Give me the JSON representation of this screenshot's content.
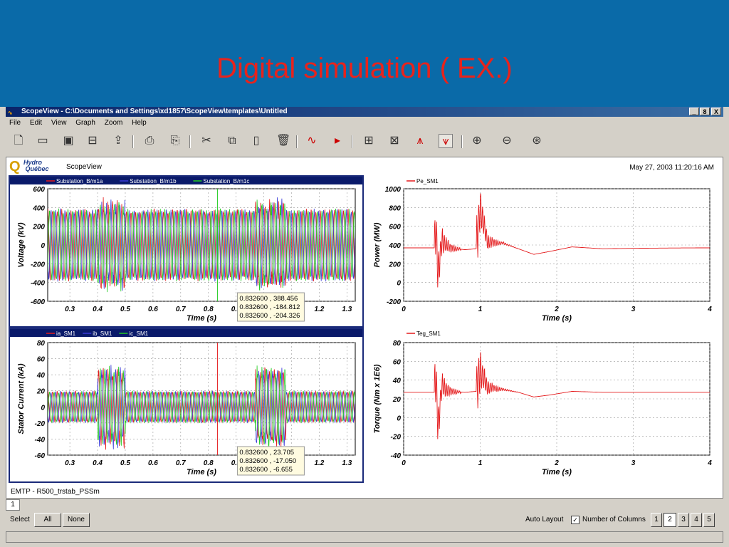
{
  "slide": {
    "title": "Digital simulation ( EX.)",
    "background": "#0a6aa8",
    "title_color": "#e8231c"
  },
  "window": {
    "title": "ScopeView - C:\\Documents and Settings\\xd1857\\ScopeView\\templates\\Untitled",
    "controls": [
      "_",
      "8",
      "X"
    ],
    "app_icon": "scopeview-logo-icon"
  },
  "menu": [
    "File",
    "Edit",
    "View",
    "Graph",
    "Zoom",
    "Help"
  ],
  "toolbar": {
    "icons": [
      "new-icon",
      "open-icon",
      "save-icon",
      "save-as-icon",
      "export-icon",
      "print-icon",
      "print-preview-icon",
      "cut-icon",
      "copy-icon",
      "paste-icon",
      "delete-icon",
      "add-signal-icon",
      "play-signal-icon",
      "layout-icon",
      "layout2-icon",
      "cursor-icon",
      "cursor-active-icon",
      "zoom-in-icon",
      "zoom-out-icon",
      "zoom-fit-icon"
    ]
  },
  "header": {
    "logo_line1": "Hydro",
    "logo_line2": "Québec",
    "app_name": "ScopeView",
    "timestamp": "May 27, 2003 11:20:16 AM"
  },
  "footer": {
    "case_name": "EMTP - R500_trstab_PSSm"
  },
  "tab": {
    "label": "1"
  },
  "bottombar": {
    "select_label": "Select",
    "all_label": "All",
    "none_label": "None",
    "auto_layout_label": "Auto Layout",
    "auto_layout_checked": "✓",
    "columns_label": "Number of Columns",
    "columns": [
      "1",
      "2",
      "3",
      "4",
      "5"
    ],
    "selected_column": "2"
  },
  "chart_data": [
    {
      "type": "line",
      "ylabel": "Voltage (kV)",
      "xlabel": "Time (s)",
      "xlim": [
        0.22,
        1.33
      ],
      "ylim": [
        -600,
        600
      ],
      "xticks": [
        "0.3",
        "0.4",
        "0.5",
        "0.6",
        "0.7",
        "0.8",
        "0.9",
        "1",
        "1.1",
        "1.2",
        "1.3"
      ],
      "yticks": [
        "600",
        "400",
        "200",
        "0",
        "-200",
        "-400",
        "-600"
      ],
      "series": [
        {
          "name": "Substation_B/m1a",
          "color": "#e41a1c"
        },
        {
          "name": "Substation_B/m1b",
          "color": "#3b3bd9"
        },
        {
          "name": "Substation_B/m1c",
          "color": "#22cc22"
        }
      ],
      "cursor_x": 0.8326,
      "cursor_readouts": [
        "0.832600 , 388.456",
        "0.832600 , -184.812",
        "0.832600 , -204.326"
      ],
      "grid": true,
      "legend": "top"
    },
    {
      "type": "line",
      "ylabel": "Power (MW)",
      "xlabel": "Time (s)",
      "xlim": [
        0,
        4
      ],
      "ylim": [
        -200,
        1000
      ],
      "xticks": [
        "0",
        "1",
        "2",
        "3",
        "4"
      ],
      "yticks": [
        "1000",
        "800",
        "600",
        "400",
        "200",
        "0",
        "-200"
      ],
      "series": [
        {
          "name": "Pe_SM1",
          "color": "#e41a1c",
          "x": [
            0,
            0.4,
            0.42,
            0.45,
            0.5,
            0.6,
            0.8,
            0.95,
            1.0,
            1.1,
            1.3,
            1.5,
            1.7,
            1.9,
            2.2,
            2.6,
            3.0,
            3.5,
            4.0
          ],
          "y": [
            370,
            370,
            600,
            100,
            450,
            370,
            350,
            360,
            800,
            430,
            420,
            360,
            300,
            330,
            380,
            360,
            365,
            368,
            370
          ]
        }
      ],
      "grid": true,
      "legend": "top"
    },
    {
      "type": "line",
      "ylabel": "Stator Current (kA)",
      "xlabel": "Time (s)",
      "xlim": [
        0.22,
        1.33
      ],
      "ylim": [
        -60,
        80
      ],
      "xticks": [
        "0.3",
        "0.4",
        "0.5",
        "0.6",
        "0.7",
        "0.8",
        "0.9",
        "1",
        "1.1",
        "1.2",
        "1.3"
      ],
      "yticks": [
        "80",
        "60",
        "40",
        "20",
        "0",
        "-20",
        "-40",
        "-60"
      ],
      "series": [
        {
          "name": "ia_SM1",
          "color": "#e41a1c"
        },
        {
          "name": "ib_SM1",
          "color": "#3b3bd9"
        },
        {
          "name": "ic_SM1",
          "color": "#22cc22"
        }
      ],
      "cursor_x": 0.8326,
      "cursor_readouts": [
        "0.832600 , 23.705",
        "0.832600 , -17.050",
        "0.832600 , -6.655"
      ],
      "grid": true,
      "legend": "top"
    },
    {
      "type": "line",
      "ylabel": "Torque (Nm x 1E6)",
      "xlabel": "Time (s)",
      "xlim": [
        0,
        4
      ],
      "ylim": [
        -40,
        80
      ],
      "xticks": [
        "0",
        "1",
        "2",
        "3",
        "4"
      ],
      "yticks": [
        "80",
        "60",
        "40",
        "20",
        "0",
        "-20",
        "-40"
      ],
      "series": [
        {
          "name": "Teg_SM1",
          "color": "#e41a1c",
          "x": [
            0,
            0.4,
            0.42,
            0.45,
            0.5,
            0.6,
            0.8,
            0.95,
            1.0,
            1.1,
            1.3,
            1.5,
            1.7,
            1.9,
            2.2,
            2.6,
            3.0,
            3.5,
            4.0
          ],
          "y": [
            27,
            27,
            45,
            -10,
            35,
            28,
            27,
            28,
            50,
            32,
            30,
            27,
            22,
            24,
            28,
            27,
            27,
            27,
            27
          ]
        }
      ],
      "grid": true,
      "legend": "top"
    }
  ]
}
